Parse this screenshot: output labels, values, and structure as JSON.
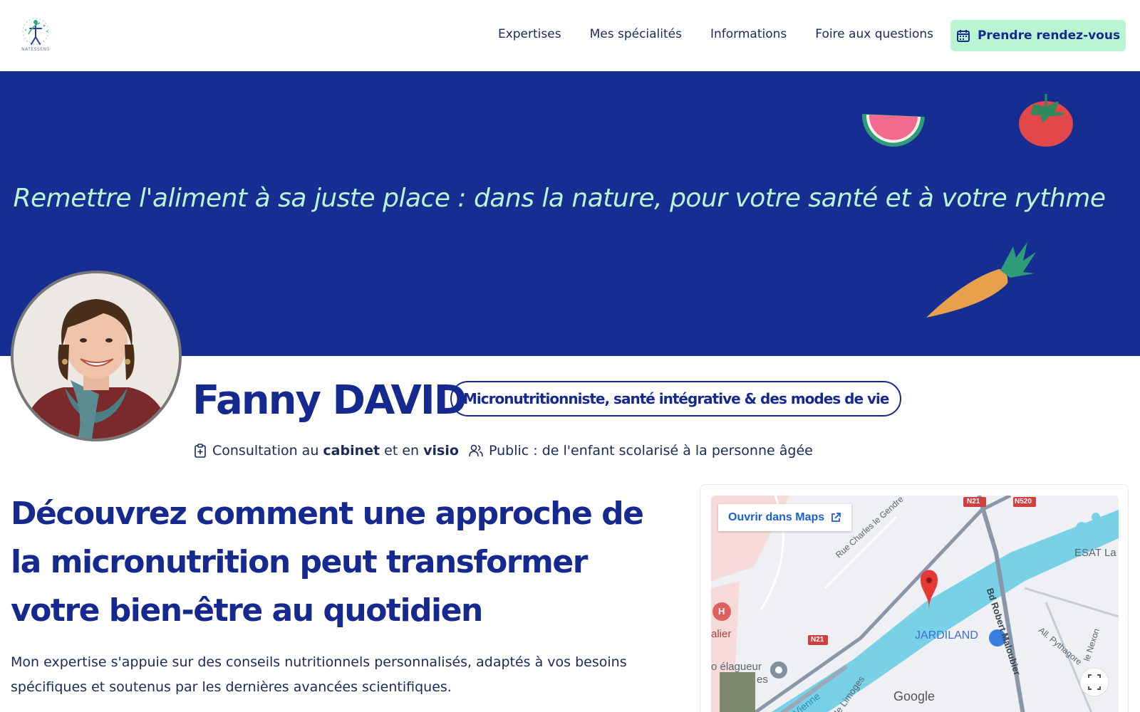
{
  "header": {
    "logo_text": "NATESSENS",
    "nav": [
      "Expertises",
      "Mes spécialités",
      "Informations",
      "Foire aux questions"
    ],
    "cta_label": "Prendre rendez-vous"
  },
  "hero": {
    "tagline": "Remettre l'aliment à sa juste place : dans la nature, pour votre santé et à votre rythme"
  },
  "profile": {
    "name": "Fanny DAVID",
    "title_badge": "Micronutritionniste, santé intégrative & des modes de vie",
    "consultation": {
      "prefix": "Consultation au",
      "place1": "cabinet",
      "mid": "et en",
      "place2": "visio"
    },
    "public": "Public : de l'enfant scolarisé à la personne âgée"
  },
  "content": {
    "headline": "Découvrez comment une approche de la micronutrition peut transformer votre bien-être au quotidien",
    "intro": "Mon expertise s'appuie sur des conseils nutritionnels personnalisés, adaptés à vos besoins spécifiques et soutenus par les dernières avancées scientifiques."
  },
  "map": {
    "open_label": "Ouvrir dans Maps",
    "labels": {
      "street1": "Rue Charles le Gendre",
      "street2": "Bd Robert Maloubier",
      "street3": "All. Pythagore",
      "street4": "le Nexon",
      "store": "JARDILAND",
      "esat": "ESAT La",
      "road1": "N520",
      "road2": "N21",
      "road3": "N21",
      "river": "Vienne",
      "street5": "v. de Limoges",
      "left1": "alier",
      "left2": "o élagueur",
      "left3": "es",
      "hospital": "H",
      "brand": "Google"
    }
  },
  "colors": {
    "primary": "#16298f",
    "hero_bg": "#162e91",
    "accent_mint": "#b9f5d3",
    "text": "#1a2a5a"
  }
}
